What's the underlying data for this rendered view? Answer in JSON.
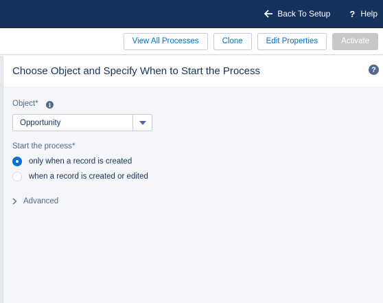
{
  "topbar": {
    "back_label": "Back To Setup",
    "help_label": "Help",
    "background_color": "#16325c"
  },
  "toolbar": {
    "view_all_label": "View All Processes",
    "clone_label": "Clone",
    "edit_properties_label": "Edit Properties",
    "activate_label": "Activate"
  },
  "panel": {
    "title": "Choose Object and Specify When to Start the Process",
    "help_glyph": "?"
  },
  "object_field": {
    "label": "Object",
    "required_mark": "*",
    "info_glyph": "i",
    "value": "Opportunity"
  },
  "start_process": {
    "label": "Start the process",
    "required_mark": "*",
    "options": [
      {
        "label": "only when a record is created",
        "selected": true
      },
      {
        "label": "when a record is created or edited",
        "selected": false
      }
    ]
  },
  "advanced": {
    "label": "Advanced"
  },
  "colors": {
    "accent": "#0070d2",
    "text": "#16325c",
    "muted": "#54698d"
  }
}
